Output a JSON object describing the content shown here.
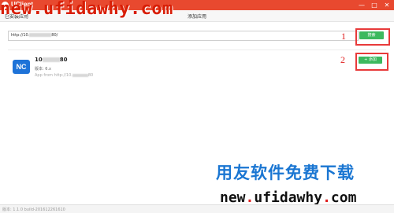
{
  "app": {
    "name": "UClient",
    "minimize": "—",
    "maximize": "□",
    "close": "✕"
  },
  "watermark": {
    "top": "new.ufidawhy.com",
    "cn": "用友软件免费下载",
    "url_a": "new",
    "url_dot1": ".",
    "url_b": "ufidawhy",
    "url_dot2": ".",
    "url_c": "com"
  },
  "tabs": [
    {
      "label": "已安装应用"
    },
    {
      "label": "添加应用"
    }
  ],
  "address": {
    "prefix": "http://10.",
    "suffix": "80/",
    "button": "搜索"
  },
  "app_item": {
    "title_prefix": "10",
    "title_suffix": "80",
    "icon": "NC",
    "version": "版本: 6.x",
    "from_prefix": "App from http://10.",
    "from_suffix": "80",
    "button": "+ 添加"
  },
  "annotations": {
    "n1": "1",
    "n2": "2"
  },
  "status": {
    "text": "版本: 1.1.0 build-201612261610"
  }
}
